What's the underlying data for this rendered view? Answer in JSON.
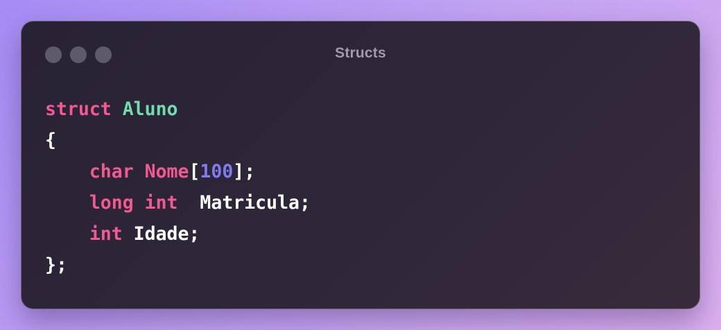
{
  "window": {
    "title": "Structs",
    "controls": [
      "close-dot",
      "minimize-dot",
      "maximize-dot"
    ]
  },
  "code": {
    "language": "c",
    "lines": [
      [
        {
          "t": "struct",
          "k": "kw"
        },
        {
          "t": " ",
          "k": "pl"
        },
        {
          "t": "Aluno",
          "k": "ty"
        }
      ],
      [
        {
          "t": "{",
          "k": "pl"
        }
      ],
      [
        {
          "t": "    ",
          "k": "pl"
        },
        {
          "t": "char",
          "k": "kw"
        },
        {
          "t": " ",
          "k": "pl"
        },
        {
          "t": "Nome",
          "k": "kw"
        },
        {
          "t": "[",
          "k": "pl"
        },
        {
          "t": "100",
          "k": "num"
        },
        {
          "t": "];",
          "k": "pl"
        }
      ],
      [
        {
          "t": "    ",
          "k": "pl"
        },
        {
          "t": "long",
          "k": "kw"
        },
        {
          "t": " ",
          "k": "pl"
        },
        {
          "t": "int",
          "k": "kw"
        },
        {
          "t": "  Matricula;",
          "k": "pl"
        }
      ],
      [
        {
          "t": "    ",
          "k": "pl"
        },
        {
          "t": "int",
          "k": "kw"
        },
        {
          "t": " Idade;",
          "k": "pl"
        }
      ],
      [
        {
          "t": "};",
          "k": "pl"
        }
      ]
    ]
  },
  "colors": {
    "keyword": "#f2598e",
    "type_name": "#70ddaa",
    "number": "#7f7cf0",
    "plain": "#ffffff",
    "window_bg": "#2a2436",
    "title_text": "#a09aa9"
  }
}
